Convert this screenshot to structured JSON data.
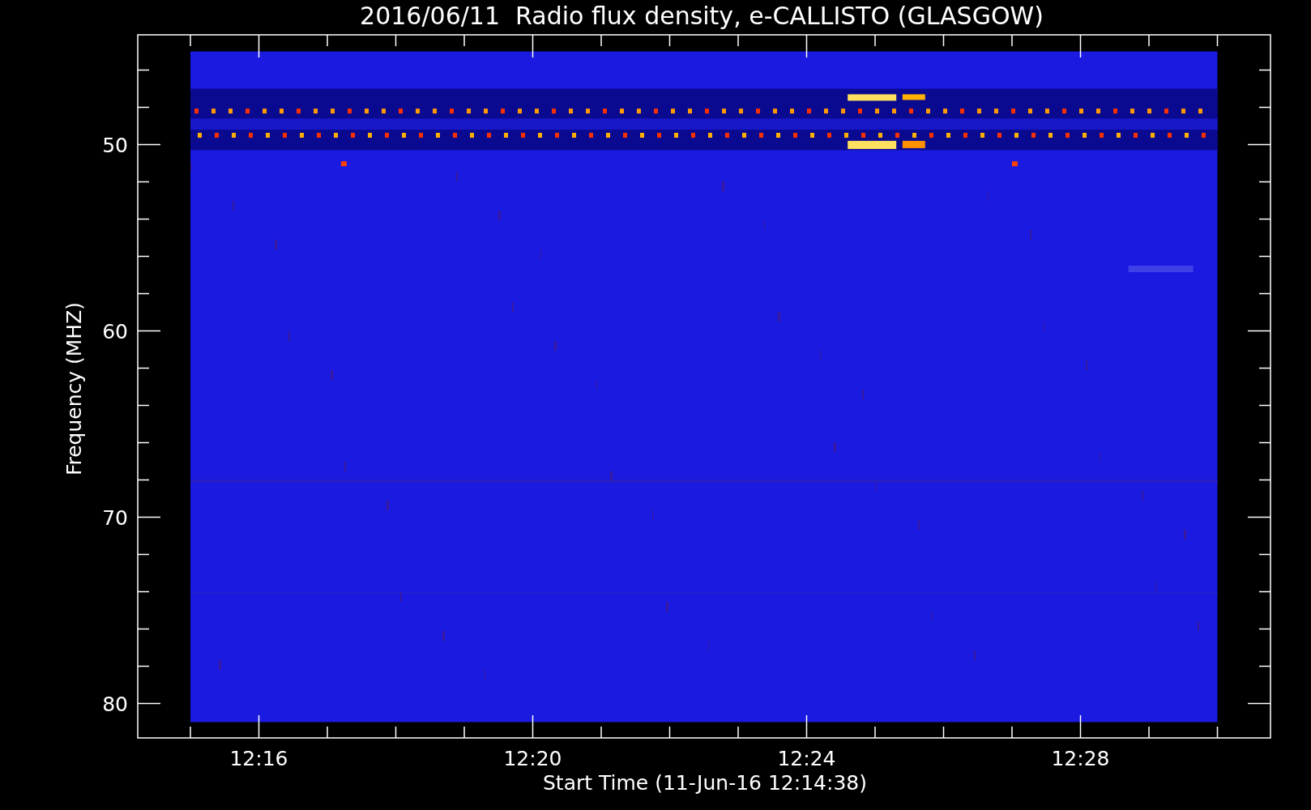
{
  "title": "2016/06/11  Radio flux density, e-CALLISTO (GLASGOW)",
  "xlabel": "Start Time (11-Jun-16 12:14:38)",
  "ylabel": "Frequency (MHZ)",
  "xtick_labels": [
    "12:16",
    "12:20",
    "12:24",
    "12:28"
  ],
  "ytick_labels": [
    "50",
    "60",
    "70",
    "80"
  ]
}
